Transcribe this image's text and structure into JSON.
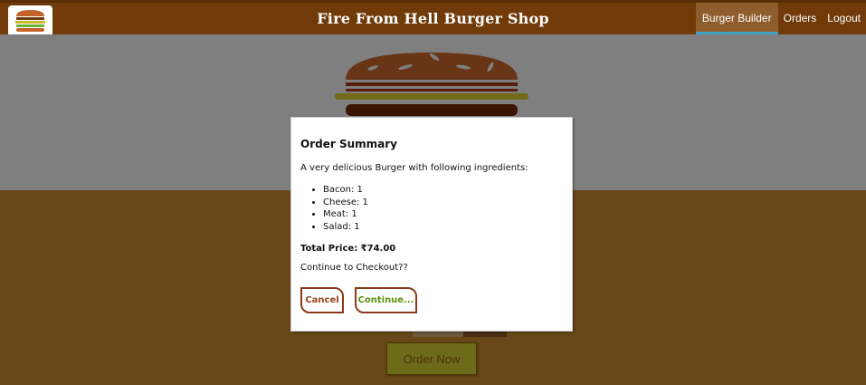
{
  "header": {
    "title": "Fire From Hell Burger Shop",
    "nav": [
      {
        "label": "Burger Builder",
        "active": true
      },
      {
        "label": "Orders",
        "active": false
      },
      {
        "label": "Logout",
        "active": false
      }
    ]
  },
  "builder": {
    "order_button_label": "Order Now"
  },
  "modal": {
    "title": "Order Summary",
    "description": "A very delicious Burger with following ingredients:",
    "ingredients": [
      {
        "label": "Bacon: 1"
      },
      {
        "label": "Cheese: 1"
      },
      {
        "label": "Meat: 1"
      },
      {
        "label": "Salad: 1"
      }
    ],
    "total_price": "Total Price: ₹74.00",
    "checkout_question": "Continue to Checkout??",
    "cancel_label": "Cancel",
    "continue_label": "Continue..."
  },
  "colors": {
    "toolbar": "#703b09",
    "controls_bg": "#cf8f2e",
    "order_button": "#dad735",
    "cancel_text": "#944317",
    "continue_text": "#5c9210"
  }
}
